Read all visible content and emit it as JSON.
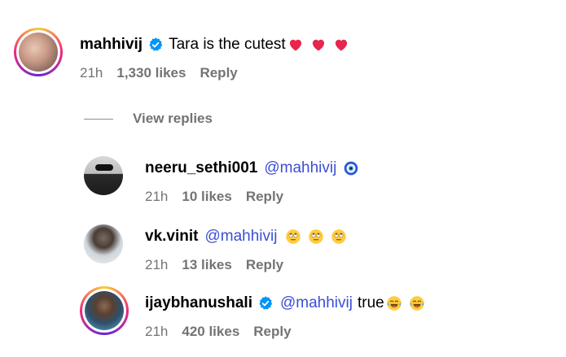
{
  "comments": [
    {
      "username": "mahhivij",
      "verified": true,
      "text": "Tara is the cutest",
      "mention": "",
      "trailing_text": "",
      "emojis": [
        "red-heart",
        "red-heart",
        "red-heart"
      ],
      "time": "21h",
      "likes": "1,330 likes",
      "reply": "Reply"
    }
  ],
  "view_replies": "View replies",
  "replies": [
    {
      "username": "neeru_sethi001",
      "verified": false,
      "mention": "@mahhivij",
      "trailing_text": "",
      "emojis": [
        "nazar-amulet"
      ],
      "time": "21h",
      "likes": "10 likes",
      "reply": "Reply"
    },
    {
      "username": "vk.vinit",
      "verified": false,
      "mention": "@mahhivij",
      "trailing_text": "",
      "emojis": [
        "face-with-rolling-eyes",
        "face-with-rolling-eyes",
        "face-with-rolling-eyes"
      ],
      "time": "21h",
      "likes": "13 likes",
      "reply": "Reply"
    },
    {
      "username": "ijaybhanushali",
      "verified": true,
      "mention": "@mahhivij",
      "trailing_text": "true",
      "emojis": [
        "face-with-tears-of-joy",
        "face-with-tears-of-joy"
      ],
      "time": "21h",
      "likes": "420 likes",
      "reply": "Reply"
    }
  ],
  "colors": {
    "mention": "#3a4ed6",
    "meta_gray": "#737373",
    "verified_blue": "#0095f6"
  }
}
